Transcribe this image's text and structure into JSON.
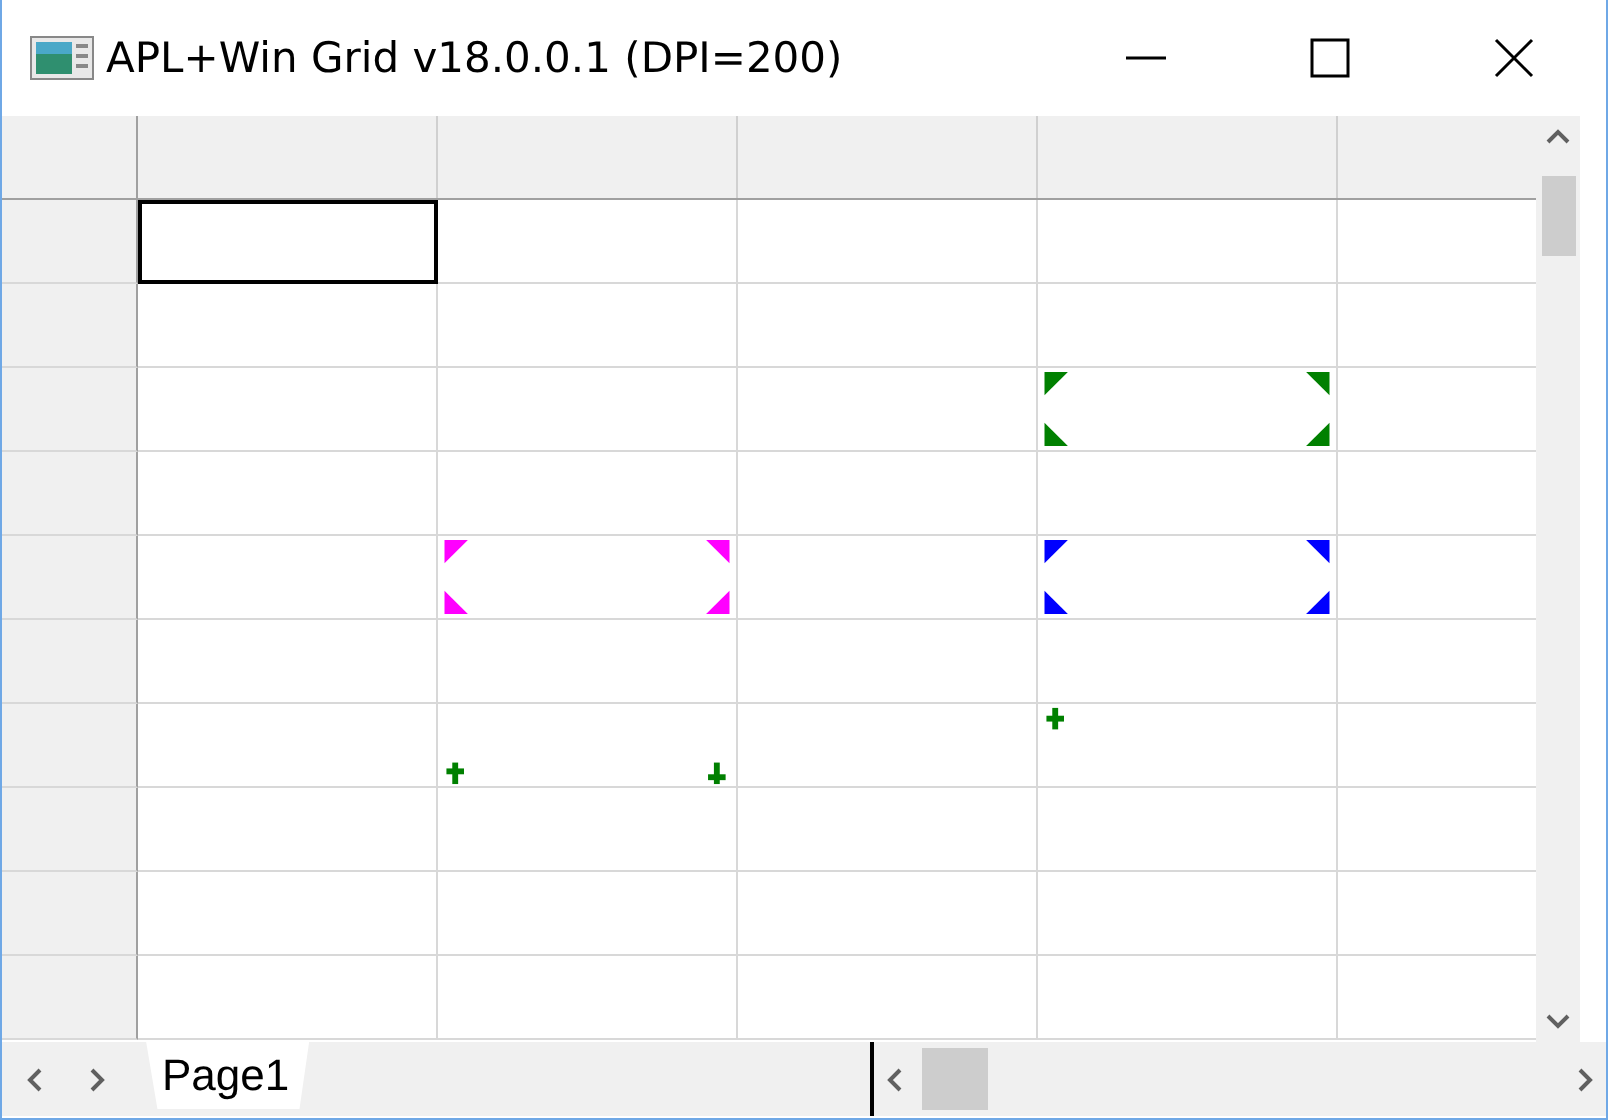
{
  "window": {
    "title": "APL+Win Grid v18.0.0.1 (DPI=200)"
  },
  "grid": {
    "rows": [
      {
        "cells": [
          {
            "kind": "empty",
            "selected": true
          },
          {
            "kind": "empty",
            "selected": false
          },
          {
            "kind": "empty",
            "selected": false
          },
          {
            "kind": "empty",
            "selected": false
          },
          {
            "kind": "empty",
            "selected": false
          }
        ]
      },
      {
        "cells": [
          {
            "kind": "empty",
            "selected": false
          },
          {
            "kind": "empty",
            "selected": false
          },
          {
            "kind": "empty",
            "selected": false
          },
          {
            "kind": "empty",
            "selected": false
          },
          {
            "kind": "empty",
            "selected": false
          }
        ]
      },
      {
        "cells": [
          {
            "kind": "empty",
            "selected": false
          },
          {
            "kind": "empty",
            "selected": false
          },
          {
            "kind": "empty",
            "selected": false
          },
          {
            "kind": "corners",
            "color": "#008000",
            "selected": false
          },
          {
            "kind": "empty",
            "selected": false
          }
        ]
      },
      {
        "cells": [
          {
            "kind": "empty",
            "selected": false
          },
          {
            "kind": "empty",
            "selected": false
          },
          {
            "kind": "empty",
            "selected": false
          },
          {
            "kind": "empty",
            "selected": false
          },
          {
            "kind": "empty",
            "selected": false
          }
        ]
      },
      {
        "cells": [
          {
            "kind": "empty",
            "selected": false
          },
          {
            "kind": "corners",
            "color": "#ff00ff",
            "selected": false
          },
          {
            "kind": "empty",
            "selected": false
          },
          {
            "kind": "corners",
            "color": "#0000ff",
            "selected": false
          },
          {
            "kind": "empty",
            "selected": false
          }
        ]
      },
      {
        "cells": [
          {
            "kind": "empty",
            "selected": false
          },
          {
            "kind": "empty",
            "selected": false
          },
          {
            "kind": "empty",
            "selected": false
          },
          {
            "kind": "empty",
            "selected": false
          },
          {
            "kind": "empty",
            "selected": false
          }
        ]
      },
      {
        "cells": [
          {
            "kind": "empty",
            "selected": false
          },
          {
            "kind": "plus-bottom",
            "selected": false
          },
          {
            "kind": "empty",
            "selected": false
          },
          {
            "kind": "plus-top",
            "selected": false
          },
          {
            "kind": "empty",
            "selected": false
          }
        ]
      },
      {
        "cells": [
          {
            "kind": "empty",
            "selected": false
          },
          {
            "kind": "empty",
            "selected": false
          },
          {
            "kind": "empty",
            "selected": false
          },
          {
            "kind": "empty",
            "selected": false
          },
          {
            "kind": "empty",
            "selected": false
          }
        ]
      },
      {
        "cells": [
          {
            "kind": "empty",
            "selected": false
          },
          {
            "kind": "empty",
            "selected": false
          },
          {
            "kind": "empty",
            "selected": false
          },
          {
            "kind": "empty",
            "selected": false
          },
          {
            "kind": "empty",
            "selected": false
          }
        ]
      },
      {
        "cells": [
          {
            "kind": "empty",
            "selected": false
          },
          {
            "kind": "empty",
            "selected": false
          },
          {
            "kind": "empty",
            "selected": false
          },
          {
            "kind": "empty",
            "selected": false
          },
          {
            "kind": "empty",
            "selected": false
          }
        ]
      }
    ]
  },
  "tabs": [
    {
      "label": "Page1",
      "selected": true
    }
  ]
}
